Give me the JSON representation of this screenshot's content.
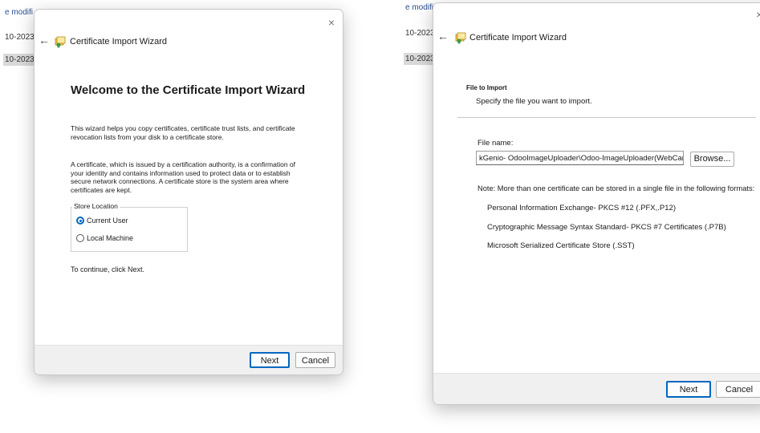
{
  "background": {
    "left": {
      "header": "e modifi",
      "rows": [
        "10-2023",
        "10-2023"
      ]
    },
    "right": {
      "header": "e modifi",
      "rows": [
        "10-2023",
        "10-2023"
      ]
    }
  },
  "wizard_left": {
    "title": "Certificate Import Wizard",
    "close": "×",
    "back": "←",
    "heading": "Welcome to the Certificate Import Wizard",
    "para1": "This wizard helps you copy certificates, certificate trust lists, and certificate revocation lists from your disk to a certificate store.",
    "para2": "A certificate, which is issued by a certification authority, is a confirmation of your identity and contains information used to protect data or to establish secure network connections. A certificate store is the system area where certificates are kept.",
    "store_location": {
      "label": "Store Location",
      "options": [
        "Current User",
        "Local Machine"
      ],
      "selected": "Current User"
    },
    "continue_text": "To continue, click Next.",
    "next_label": "Next",
    "cancel_label": "Cancel"
  },
  "wizard_right": {
    "title": "Certificate Import Wizard",
    "close": "×",
    "back": "←",
    "section_title": "File to Import",
    "section_subtitle": "Specify the file you want to import.",
    "file_name_label": "File name:",
    "file_name_value": "kGenio- OdooImageUploader\\Odoo-ImageUploader(WebCam).pfx",
    "browse_label": "Browse...",
    "note": "Note:  More than one certificate can be stored in a single file in the following formats:",
    "formats": [
      "Personal Information Exchange- PKCS #12 (.PFX,.P12)",
      "Cryptographic Message Syntax Standard- PKCS #7 Certificates (.P7B)",
      "Microsoft Serialized Certificate Store (.SST)"
    ],
    "next_label": "Next",
    "cancel_label": "Cancel"
  },
  "colors": {
    "accent": "#0067c0",
    "footer": "#f0f0f0"
  },
  "icons": {
    "title_icon": "certificate-icon",
    "back": "back-arrow-icon",
    "close": "close-icon"
  }
}
